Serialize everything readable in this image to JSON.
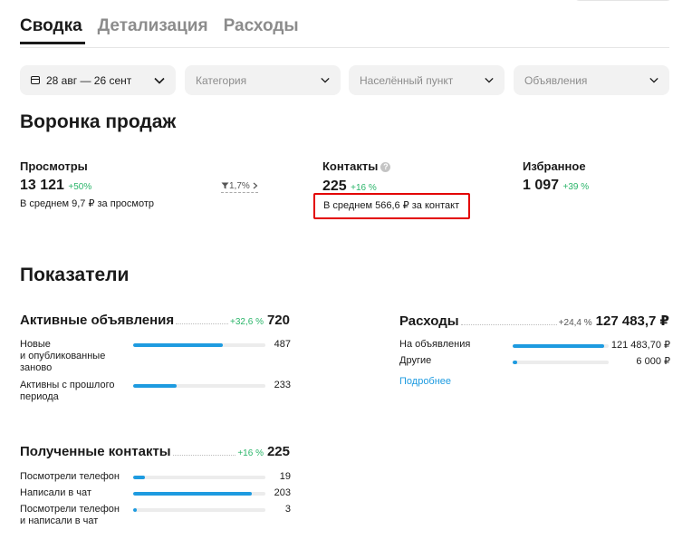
{
  "tabs": [
    {
      "label": "Сводка",
      "active": true
    },
    {
      "label": "Детализация",
      "active": false
    },
    {
      "label": "Расходы",
      "active": false
    }
  ],
  "filters": {
    "date": "28 авг — 26 сент",
    "category_placeholder": "Категория",
    "city_placeholder": "Населённый пункт",
    "ads_placeholder": "Объявления"
  },
  "funnel": {
    "title": "Воронка продаж",
    "views": {
      "label": "Просмотры",
      "value": "13 121",
      "delta": "+50%",
      "sub": "В среднем 9,7 ₽ за просмотр",
      "conversion": "1,7%"
    },
    "contacts": {
      "label": "Контакты",
      "help": "?",
      "value": "225",
      "delta": "+16 %",
      "sub": "В среднем 566,6 ₽ за контакт"
    },
    "favorites": {
      "label": "Избранное",
      "value": "1 097",
      "delta": "+39 %"
    }
  },
  "indicators": {
    "title": "Показатели",
    "active_ads": {
      "label": "Активные объявления",
      "delta": "+32,6 %",
      "total": "720",
      "rows": [
        {
          "label_line1": "Новые",
          "label_line2": "и опубликованные",
          "label_line3": "заново",
          "value": "487",
          "fraction": 0.68
        },
        {
          "label_line1": "Активны с прошлого",
          "label_line2": "периода",
          "value": "233",
          "fraction": 0.33
        }
      ]
    },
    "expenses": {
      "label": "Расходы",
      "delta": "+24,4 %",
      "total": "127 483,7 ₽",
      "rows": [
        {
          "label": "На объявления",
          "value": "121 483,70 ₽",
          "fraction": 0.95
        },
        {
          "label": "Другие",
          "value": "6 000 ₽",
          "fraction": 0.05
        }
      ],
      "more_link": "Подробнее"
    },
    "contacts": {
      "label": "Полученные контакты",
      "delta": "+16 %",
      "total": "225",
      "rows": [
        {
          "label_line1": "Посмотрели телефон",
          "value": "19",
          "fraction": 0.09
        },
        {
          "label_line1": "Написали в чат",
          "value": "203",
          "fraction": 0.9
        },
        {
          "label_line1": "Посмотрели телефон",
          "label_line2": "и написали в чат",
          "value": "3",
          "fraction": 0.03
        }
      ]
    }
  },
  "colors": {
    "accent": "#1e9be0",
    "positive": "#2bb56a",
    "highlight": "#e30000"
  }
}
